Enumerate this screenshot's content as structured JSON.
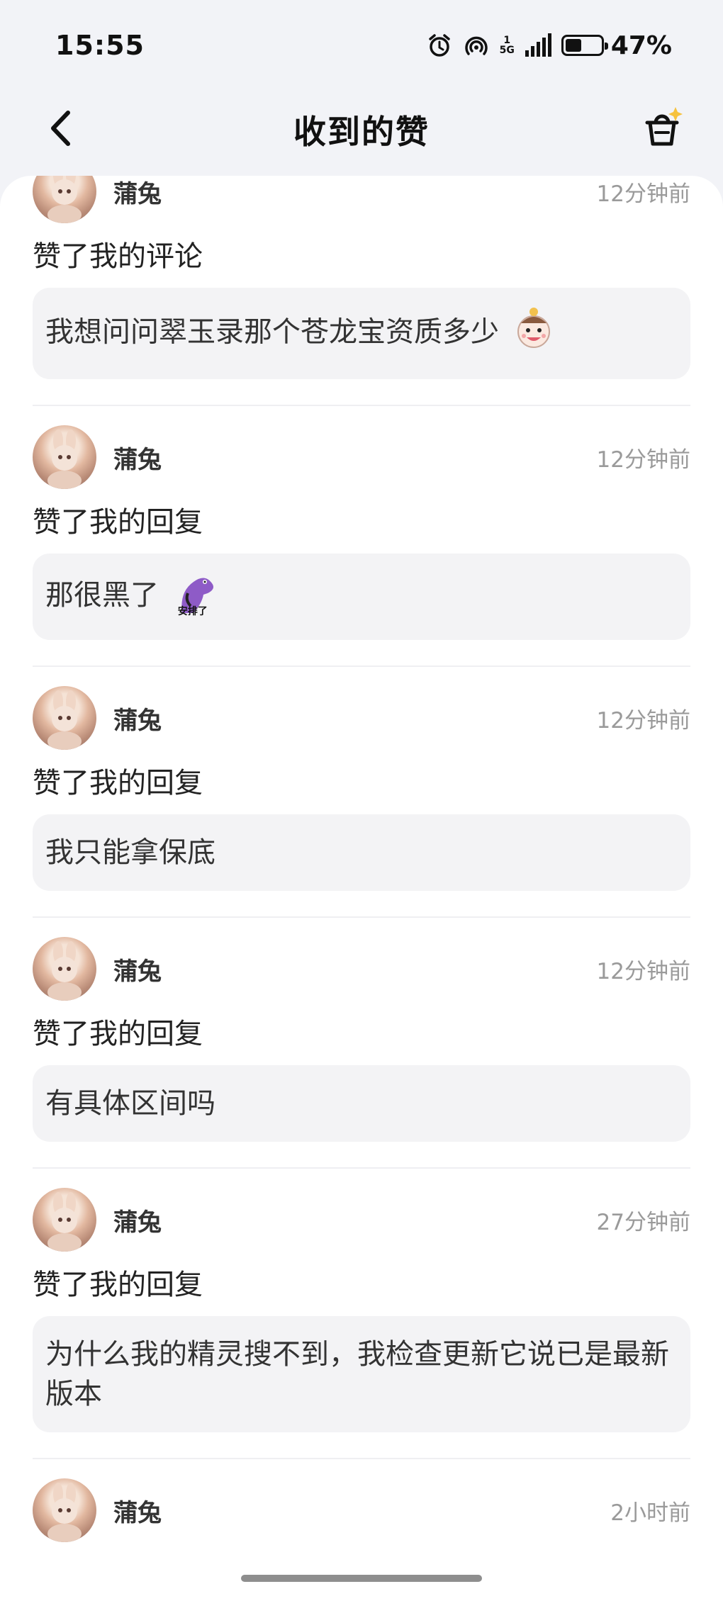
{
  "status_bar": {
    "time": "15:55",
    "network_sup": "1",
    "network_type": "5G",
    "battery_percent": "47%",
    "battery_level": 0.47,
    "icons": [
      "alarm-icon",
      "hotspot-icon",
      "signal-icon",
      "battery-icon"
    ]
  },
  "header": {
    "title": "收到的赞",
    "back_icon": "chevron-left-icon",
    "action_icon": "broom-basket-icon"
  },
  "items": [
    {
      "user": "蒲兔",
      "time": "12分钟前",
      "action": "赞了我的评论",
      "content": "我想问问翠玉录那个苍龙宝资质多少",
      "emote": "smiling-face-emote"
    },
    {
      "user": "蒲兔",
      "time": "12分钟前",
      "action": "赞了我的回复",
      "content": "那很黑了",
      "emote": "purple-dino-emote",
      "emote_caption": "安排了"
    },
    {
      "user": "蒲兔",
      "time": "12分钟前",
      "action": "赞了我的回复",
      "content": "我只能拿保底"
    },
    {
      "user": "蒲兔",
      "time": "12分钟前",
      "action": "赞了我的回复",
      "content": "有具体区间吗"
    },
    {
      "user": "蒲兔",
      "time": "27分钟前",
      "action": "赞了我的回复",
      "content": "为什么我的精灵搜不到，我检查更新它说已是最新版本"
    },
    {
      "user": "蒲兔",
      "time": "2小时前"
    }
  ]
}
